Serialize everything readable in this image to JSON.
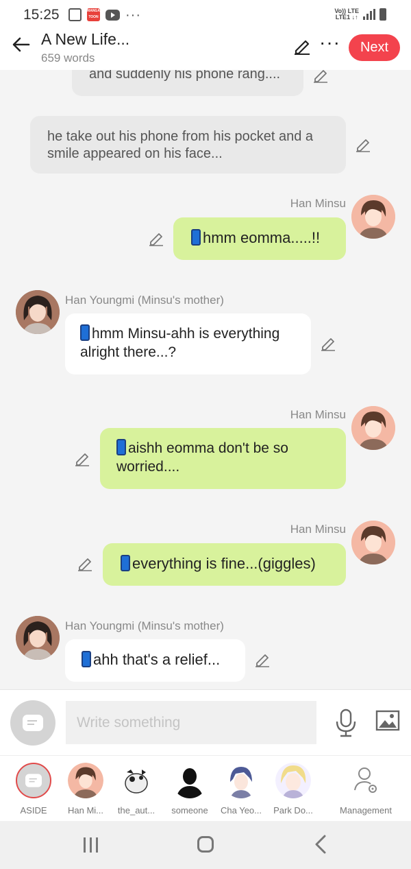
{
  "status_bar": {
    "time": "15:25",
    "network_line1": "Vo)) LTE",
    "network_line2": "LTE1 ↓↑"
  },
  "header": {
    "title": "A New Life...",
    "word_count": "659 words",
    "next_label": "Next"
  },
  "messages": [
    {
      "type": "narration",
      "text": "and suddenly his phone rang...."
    },
    {
      "type": "narration",
      "text": "he take out his phone from his pocket and a smile appeared on his face..."
    },
    {
      "type": "mine",
      "speaker": "Han Minsu",
      "text": "hmm eomma.....!!"
    },
    {
      "type": "theirs",
      "speaker": "Han Youngmi (Minsu's mother)",
      "text": "hmm Minsu-ahh is everything alright there...?"
    },
    {
      "type": "mine",
      "speaker": "Han Minsu",
      "text": "aishh eomma don't be so worried...."
    },
    {
      "type": "mine",
      "speaker": "Han Minsu",
      "text": "everything is fine...(giggles)"
    },
    {
      "type": "theirs",
      "speaker": "Han Youngmi (Minsu's mother)",
      "text": "ahh that's a relief..."
    }
  ],
  "composer": {
    "placeholder": "Write something"
  },
  "characters": [
    {
      "label": "ASIDE"
    },
    {
      "label": "Han Mi..."
    },
    {
      "label": "the_aut..."
    },
    {
      "label": "someone"
    },
    {
      "label": "Cha Yeo..."
    },
    {
      "label": "Park Do..."
    },
    {
      "label": "Management"
    }
  ],
  "colors": {
    "accent": "#f3434d",
    "my_bubble": "#d8f29c",
    "their_bubble": "#ffffff",
    "narration_bubble": "#e9e9e9"
  }
}
